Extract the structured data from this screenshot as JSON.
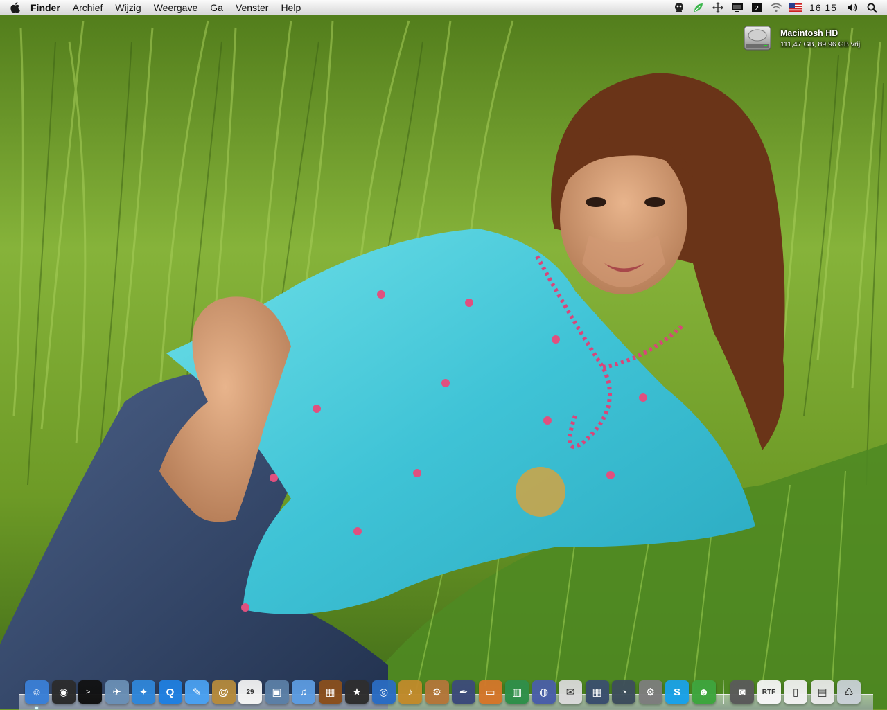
{
  "menubar": {
    "app_name": "Finder",
    "menus": [
      "Archief",
      "Wijzig",
      "Weergave",
      "Ga",
      "Venster",
      "Help"
    ],
    "clock": "16 15",
    "status_icons": [
      "bot-icon",
      "leaf-icon",
      "network-arrows-icon",
      "display-icon",
      "spaces-icon",
      "wifi-icon",
      "us-flag-icon"
    ]
  },
  "desktop": {
    "disk_name": "Macintosh HD",
    "disk_info": "111,47 GB, 89,96 GB vrij"
  },
  "dock": {
    "apps": [
      {
        "icon": "finder-icon",
        "color": "#3a7fd6",
        "glyph": "☺",
        "running": true
      },
      {
        "icon": "dashboard-icon",
        "color": "#2b2b2b",
        "glyph": "◉",
        "running": false
      },
      {
        "icon": "terminal-icon",
        "color": "#111111",
        "glyph": ">_",
        "running": false
      },
      {
        "icon": "mail-icon",
        "color": "#6a8fb5",
        "glyph": "✈",
        "running": false
      },
      {
        "icon": "safari-icon",
        "color": "#2f86d9",
        "glyph": "✦",
        "running": false
      },
      {
        "icon": "quicktime-icon",
        "color": "#1f7fe0",
        "glyph": "Q",
        "running": false
      },
      {
        "icon": "ichat-icon",
        "color": "#4aa0f0",
        "glyph": "✎",
        "running": false
      },
      {
        "icon": "address-book-icon",
        "color": "#b58a3c",
        "glyph": "@",
        "running": false
      },
      {
        "icon": "ical-icon",
        "color": "#f2f2f2",
        "glyph": "29",
        "running": false
      },
      {
        "icon": "iphoto-icon",
        "color": "#5b7fa6",
        "glyph": "▣",
        "running": false
      },
      {
        "icon": "itunes-icon",
        "color": "#5c9be0",
        "glyph": "♫",
        "running": false
      },
      {
        "icon": "photo-booth-icon",
        "color": "#8a4f1d",
        "glyph": "▦",
        "running": false
      },
      {
        "icon": "imovie-icon",
        "color": "#2e2e2e",
        "glyph": "★",
        "running": false
      },
      {
        "icon": "dvd-player-icon",
        "color": "#2a6cc2",
        "glyph": "◎",
        "running": false
      },
      {
        "icon": "garageband-icon",
        "color": "#c08a2b",
        "glyph": "♪",
        "running": false
      },
      {
        "icon": "iweb-icon",
        "color": "#b3763a",
        "glyph": "⚙",
        "running": false
      },
      {
        "icon": "script-editor-icon",
        "color": "#3c4a7a",
        "glyph": "✒",
        "running": false
      },
      {
        "icon": "keynote-icon",
        "color": "#d4762a",
        "glyph": "▭",
        "running": false
      },
      {
        "icon": "numbers-icon",
        "color": "#2f8f4a",
        "glyph": "▥",
        "running": false
      },
      {
        "icon": "firefox-icon",
        "color": "#4a5ea8",
        "glyph": "◍",
        "running": false
      },
      {
        "icon": "preview-icon",
        "color": "#d9d9d9",
        "glyph": "✉",
        "running": false
      },
      {
        "icon": "expose-icon",
        "color": "#3a4e6e",
        "glyph": "▦",
        "running": false
      },
      {
        "icon": "time-machine-icon",
        "color": "#3d4d5c",
        "glyph": "◔",
        "running": false
      },
      {
        "icon": "system-preferences-icon",
        "color": "#7d7d7d",
        "glyph": "⚙",
        "running": false
      },
      {
        "icon": "skype-icon",
        "color": "#1aa1e8",
        "glyph": "S",
        "running": false
      },
      {
        "icon": "adium-icon",
        "color": "#3ea53e",
        "glyph": "☻",
        "running": false
      }
    ],
    "stack": [
      {
        "icon": "downloads-stack-icon",
        "color": "#5a5a5a",
        "glyph": "◙"
      },
      {
        "icon": "rtf-document-icon",
        "color": "#f5f5f5",
        "glyph": "RTF"
      },
      {
        "icon": "document-icon",
        "color": "#f0f0f0",
        "glyph": "▯"
      },
      {
        "icon": "picture-document-icon",
        "color": "#e8e8e8",
        "glyph": "▤"
      },
      {
        "icon": "trash-icon",
        "color": "#c9d0d6",
        "glyph": "♺"
      }
    ]
  }
}
